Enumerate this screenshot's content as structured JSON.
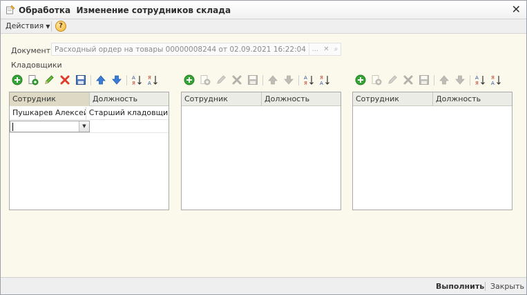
{
  "window": {
    "title": "Обработка  Изменение сотрудников склада",
    "close_glyph": "✕"
  },
  "command_bar": {
    "actions_label": "Действия",
    "help_glyph": "?"
  },
  "document": {
    "label": "Документ:",
    "value": "Расходный ордер на товары 00000008244 от 02.09.2021 16:22:04",
    "select_glyph": "...",
    "clear_glyph": "✕",
    "open_glyph": "⌕"
  },
  "section_label": "Кладовщики",
  "toolbar_icons": [
    "add-icon",
    "copy-icon",
    "edit-icon",
    "delete-icon",
    "save-icon",
    "move-up-icon",
    "move-down-icon",
    "sort-ascending-icon",
    "sort-descending-icon"
  ],
  "tables": [
    {
      "columns": [
        "Сотрудник",
        "Должность"
      ],
      "rows": [
        [
          "Пушкарев Алексей...",
          "Старший кладовщик"
        ]
      ],
      "editing_row": true
    },
    {
      "columns": [
        "Сотрудник",
        "Должность"
      ],
      "rows": []
    },
    {
      "columns": [
        "Сотрудник",
        "Должность"
      ],
      "rows": []
    }
  ],
  "footer": {
    "run_label": "Выполнить",
    "close_label": "Закрыть"
  },
  "colors": {
    "background": "#fbf8ec",
    "add": "#35a535",
    "delete": "#e03a2a",
    "arrows": "#3a7dd8"
  }
}
